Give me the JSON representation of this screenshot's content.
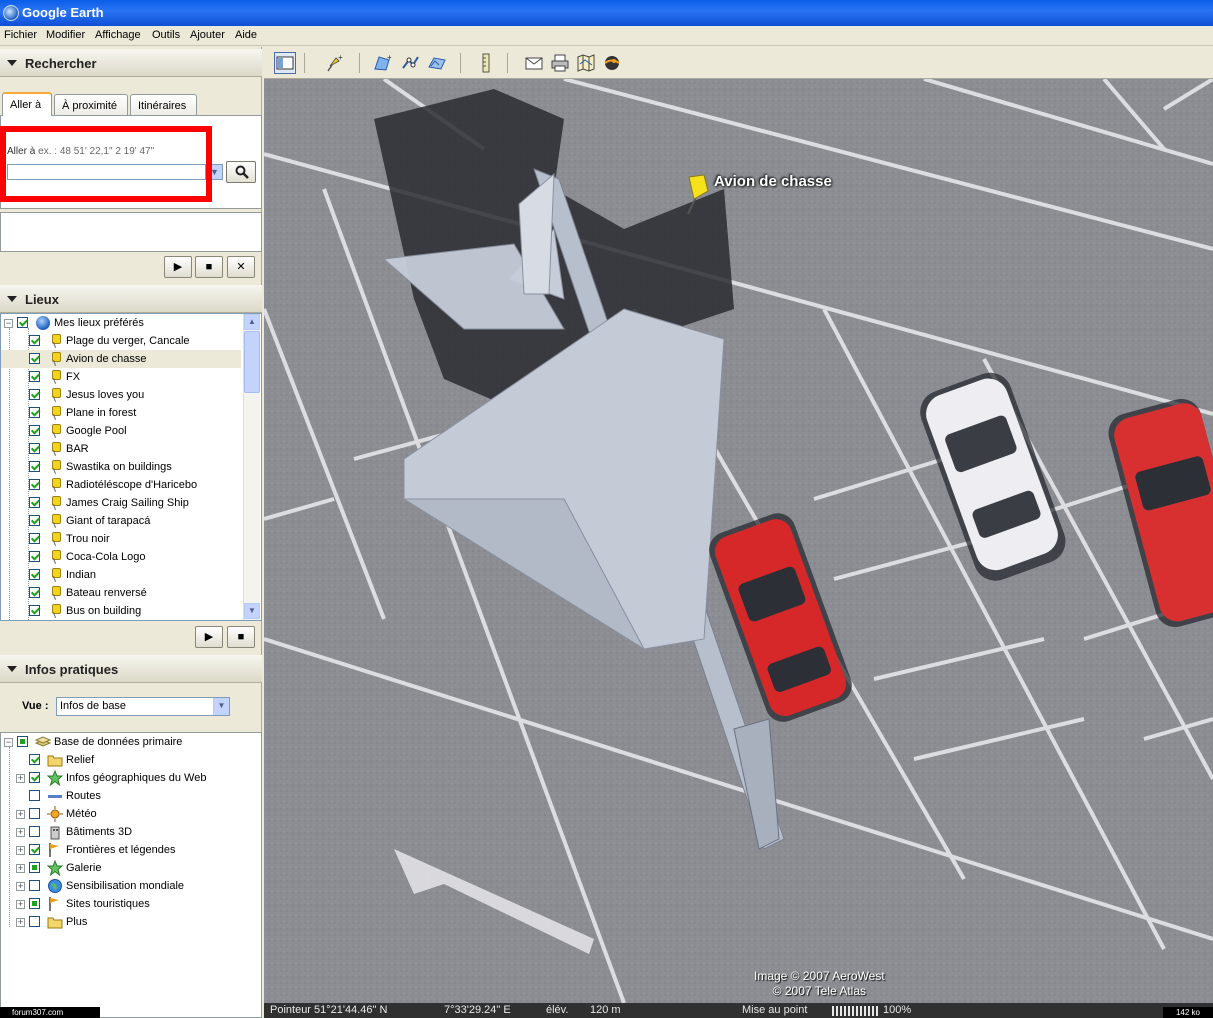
{
  "window": {
    "title": "Google Earth"
  },
  "menu": [
    "Fichier",
    "Modifier",
    "Affichage",
    "Outils",
    "Ajouter",
    "Aide"
  ],
  "search": {
    "header": "Rechercher",
    "tabs": [
      "Aller à",
      "À proximité",
      "Itinéraires"
    ],
    "goto_label": "Aller à",
    "goto_hint": "ex. : 48 51' 22,1\" 2 19' 47\"",
    "goto_value": ""
  },
  "places": {
    "header": "Lieux",
    "root": "Mes lieux préférés",
    "items": [
      "Plage du verger, Cancale",
      "Avion de chasse",
      "FX",
      "Jesus loves you",
      "Plane in forest",
      "Google Pool",
      "BAR",
      "Swastika on buildings",
      "Radiotéléscope d'Haricebo",
      "James Craig Sailing Ship",
      "Giant of tarapacá",
      "Trou noir",
      "Coca-Cola Logo",
      "Indian",
      "Bateau renversé",
      "Bus on building"
    ],
    "selected_index": 1
  },
  "layers": {
    "header": "Infos pratiques",
    "vue_label": "Vue :",
    "vue_value": "Infos de base",
    "root": "Base de données primaire",
    "items": [
      "Relief",
      "Infos géographiques du Web",
      "Routes",
      "Météo",
      "Bâtiments 3D",
      "Frontières et légendes",
      "Galerie",
      "Sensibilisation mondiale",
      "Sites touristiques",
      "Plus"
    ]
  },
  "map": {
    "placemark_label": "Avion de chasse",
    "copyright_1": "Image © 2007 AeroWest",
    "copyright_2": "© 2007 Tele Atlas"
  },
  "status": {
    "pointer": "Pointeur 51°21'44.46\" N",
    "lon": "7°33'29.24\" E",
    "elev_label": "élév.",
    "elev_value": "120 m",
    "streaming": "Mise au point",
    "streaming_pct": "100%"
  },
  "watermark": {
    "forum": "forum307.com",
    "size": "142 ko"
  },
  "colors": {
    "titlebar": "#0a5de8",
    "highlight_box": "#ff0000",
    "panel": "#ece9d8"
  }
}
